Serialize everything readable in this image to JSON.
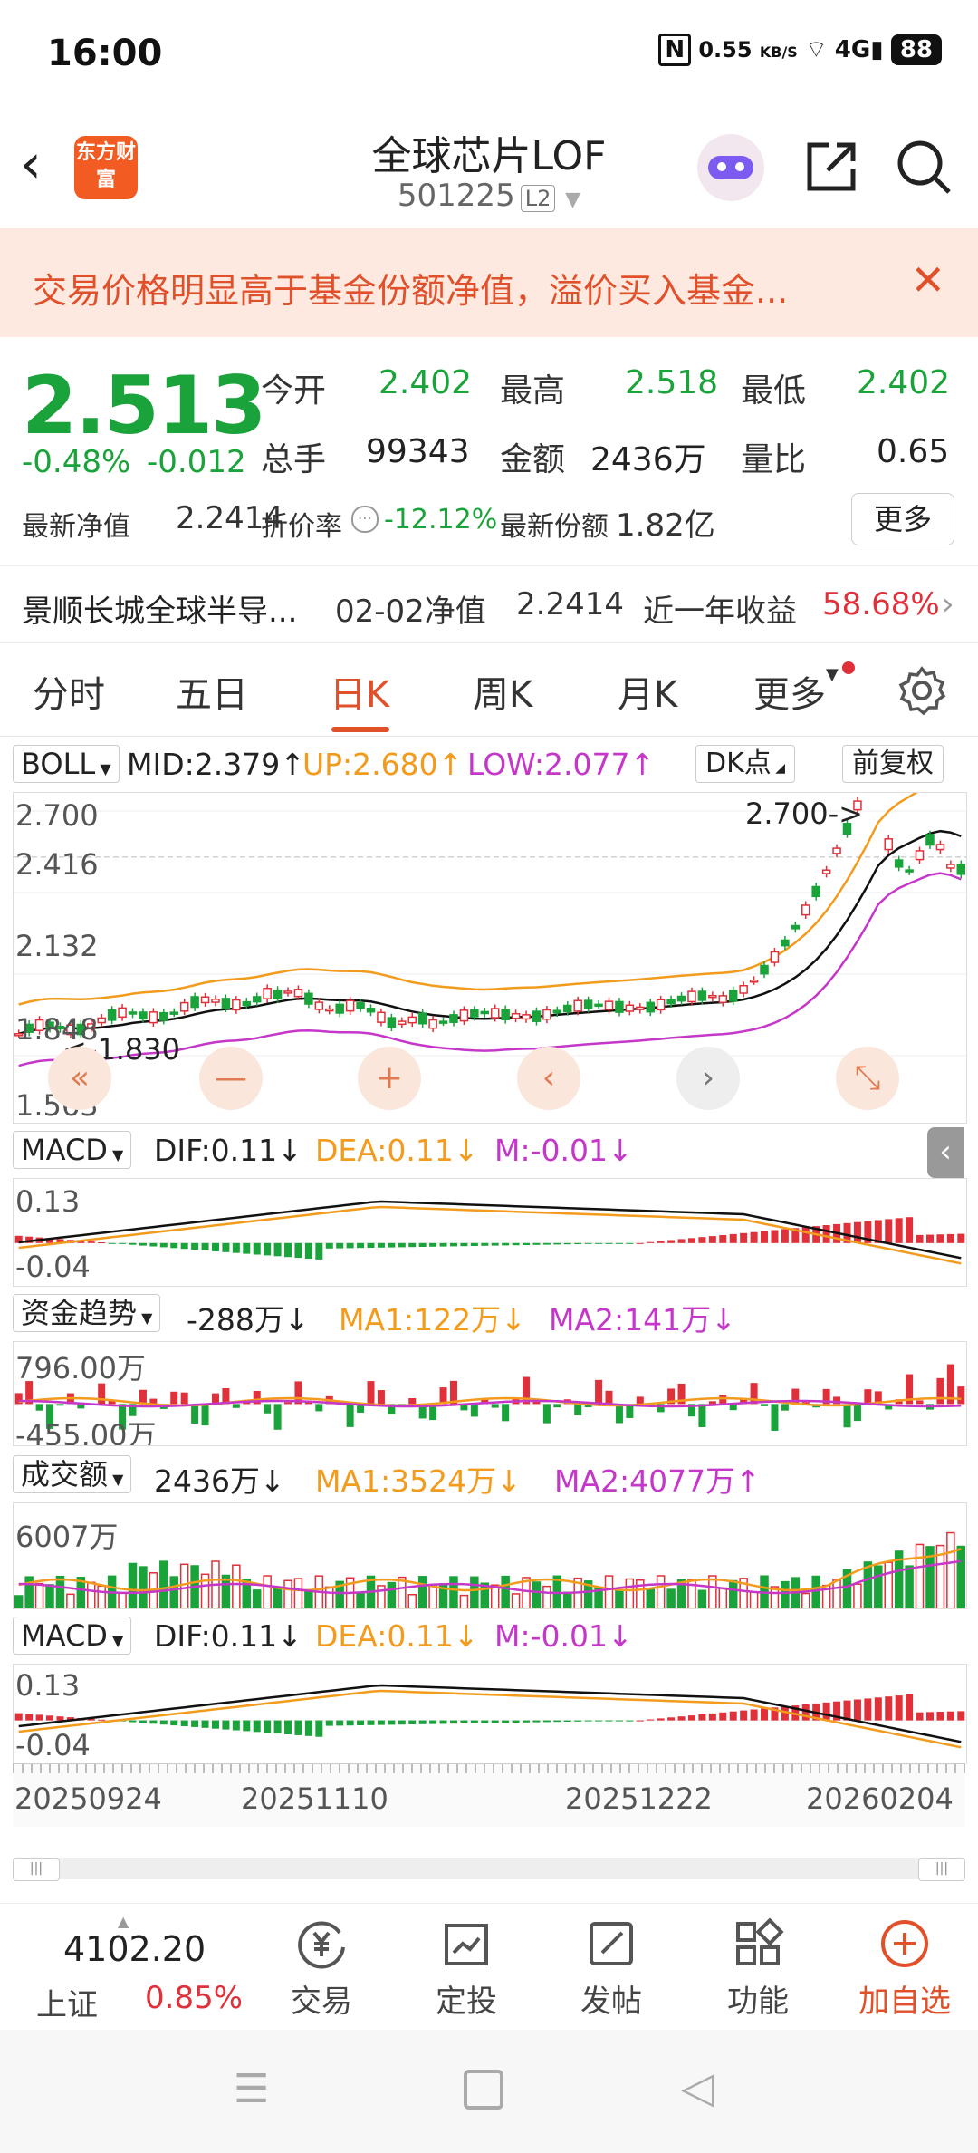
{
  "status_bar": {
    "time": "16:00",
    "net_speed": "0.55",
    "net_unit": "KB/S",
    "battery": "88"
  },
  "header": {
    "logo_text": "东方财富",
    "title": "全球芯片LOF",
    "code": "501225",
    "level": "L2"
  },
  "warning": {
    "text": "交易价格明显高于基金份额净值，溢价买入基金...",
    "close": "✕"
  },
  "quote": {
    "price": "2.513",
    "change_pct": "-0.48%",
    "change": "-0.012",
    "open_label": "今开",
    "open": "2.402",
    "high_label": "最高",
    "high": "2.518",
    "low_label": "最低",
    "low": "2.402",
    "volume_label": "总手",
    "volume": "99343",
    "amount_label": "金额",
    "amount": "2436万",
    "ratio_label": "量比",
    "ratio": "0.65",
    "nav_label": "最新净值",
    "nav": "2.2414",
    "discount_label": "折价率",
    "discount": "-12.12%",
    "shares_label": "最新份额",
    "shares": "1.82亿",
    "more": "更多"
  },
  "fund_row": {
    "name": "景顺长城全球半导...",
    "nav_date_label": "02-02净值",
    "nav": "2.2414",
    "year_label": "近一年收益",
    "year_return": "58.68%"
  },
  "tabs": [
    "分时",
    "五日",
    "日K",
    "周K",
    "月K",
    "更多"
  ],
  "active_tab": 2,
  "boll": {
    "selector": "BOLL",
    "mid": "MID:2.379↑",
    "up": "UP:2.680↑",
    "low": "LOW:2.077↑",
    "dk": "DK点",
    "fq": "前复权"
  },
  "kline": {
    "y_labels": [
      "2.700",
      "2.416",
      "2.132",
      "1.848",
      "1.563"
    ],
    "max_marker": "2.700->",
    "min_marker": "<-1.830"
  },
  "macd1": {
    "selector": "MACD",
    "dif": "DIF:0.11↓",
    "dea": "DEA:0.11↓",
    "m": "M:-0.01↓",
    "y_labels": [
      "0.13",
      "-0.04"
    ]
  },
  "flow": {
    "selector": "资金趋势",
    "value": "-288万↓",
    "ma1": "MA1:122万↓",
    "ma2": "MA2:141万↓",
    "y_labels": [
      "796.00万",
      "-455.00万"
    ]
  },
  "turnover": {
    "selector": "成交额",
    "value": "2436万↓",
    "ma1": "MA1:3524万↓",
    "ma2": "MA2:4077万↑",
    "y_labels": [
      "6007万"
    ]
  },
  "macd2": {
    "selector": "MACD",
    "dif": "DIF:0.11↓",
    "dea": "DEA:0.11↓",
    "m": "M:-0.01↓",
    "y_labels": [
      "0.13",
      "-0.04"
    ]
  },
  "dates": [
    "20250924",
    "20251110",
    "20251222",
    "20260204"
  ],
  "index": {
    "value": "4102.20",
    "name": "上证",
    "pct": "0.85%"
  },
  "bottom_nav": [
    "交易",
    "定投",
    "发帖",
    "功能",
    "加自选"
  ],
  "colors": {
    "up": "#e0303a",
    "down": "#1aa33a",
    "accent": "#e0502a",
    "orange": "#f29b1c",
    "purple": "#c537c9"
  }
}
